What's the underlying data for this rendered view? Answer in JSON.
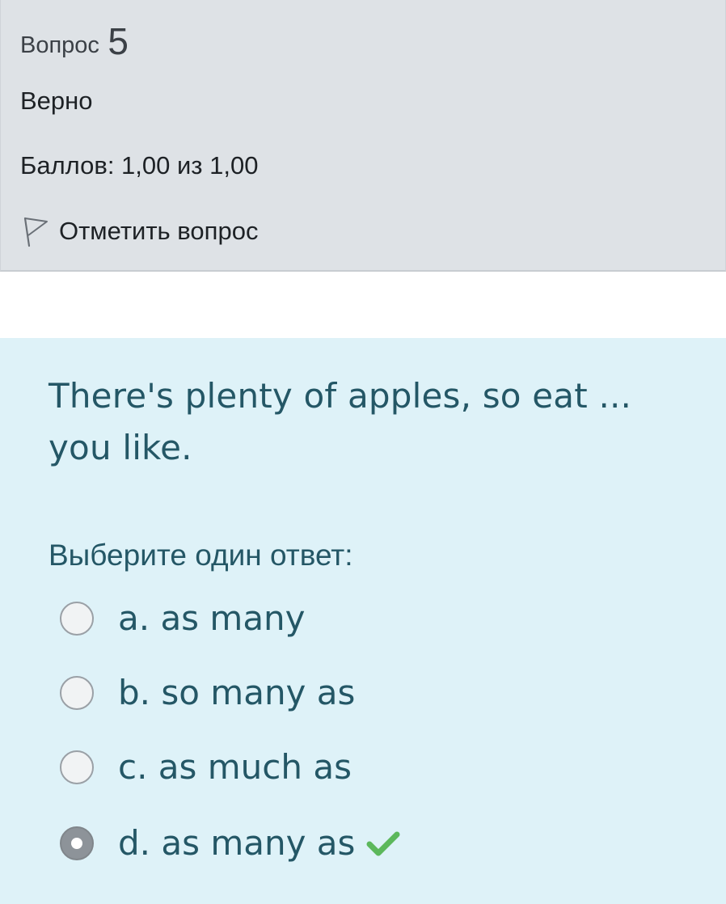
{
  "info": {
    "question_label": "Вопрос",
    "question_number": "5",
    "state": "Верно",
    "grade": "Баллов: 1,00 из 1,00",
    "flag_label": "Отметить вопрос",
    "flag_icon": "flag-outline-icon"
  },
  "question": {
    "text": "There's plenty of apples, so eat ... you like.",
    "prompt": "Выберите один ответ:",
    "answers": [
      {
        "label": "a. as many",
        "selected": false
      },
      {
        "label": "b. so many as",
        "selected": false
      },
      {
        "label": "c. as much as",
        "selected": false
      },
      {
        "label": "d. as many as",
        "selected": true,
        "correct_icon": "checkmark-icon"
      }
    ]
  },
  "colors": {
    "info_bg": "#dee2e6",
    "content_bg": "#def2f8",
    "content_text": "#245766",
    "correct_green": "#5cb85c"
  }
}
